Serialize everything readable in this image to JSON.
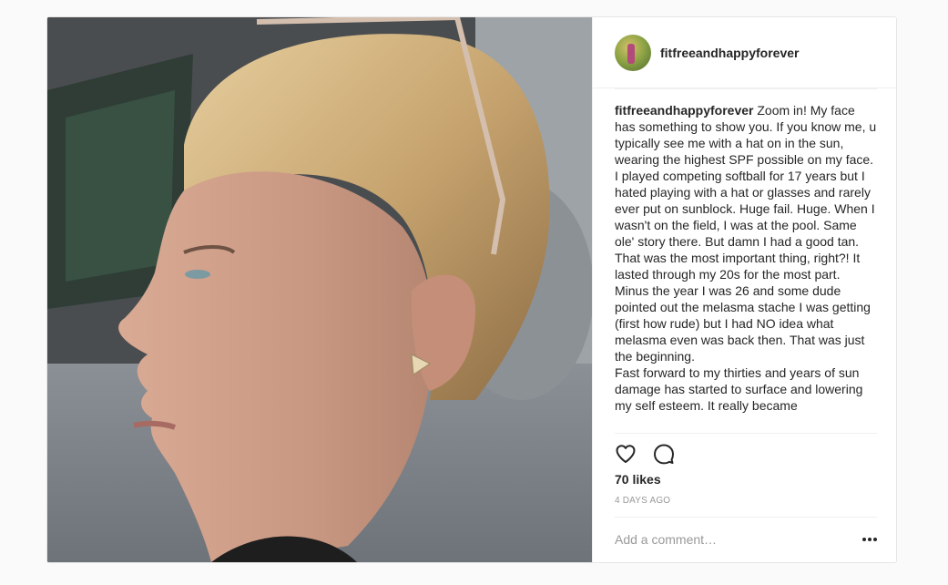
{
  "post": {
    "username": "fitfreeandhappyforever",
    "caption_text": " Zoom in! My face has something to show you. If you know me, u typically see me with a hat on in the sun, wearing the highest SPF possible on my face. I played competing softball for 17 years but I hated playing with a hat or glasses and rarely ever put on sunblock. Huge fail. Huge. When I wasn't on the field, I was at the pool. Same ole' story there. But damn I had a good tan. That was the most important thing, right?! It lasted through my 20s for the most part. Minus the year I was 26 and some dude pointed out the melasma stache I was getting (first how rude) but I had NO idea what melasma even was back then. That was just the beginning.\nFast forward to my thirties and years of sun damage has started to surface and lowering my self esteem. It really became",
    "likes": "70 likes",
    "time": "4 days ago"
  },
  "comment": {
    "placeholder": "Add a comment…"
  },
  "icons": {
    "like": "heart-icon",
    "comment": "comment-icon",
    "more": "more-options-icon"
  },
  "colors": {
    "text": "#262626",
    "muted": "#999999",
    "border": "#efefef",
    "background": "#fafafa"
  }
}
